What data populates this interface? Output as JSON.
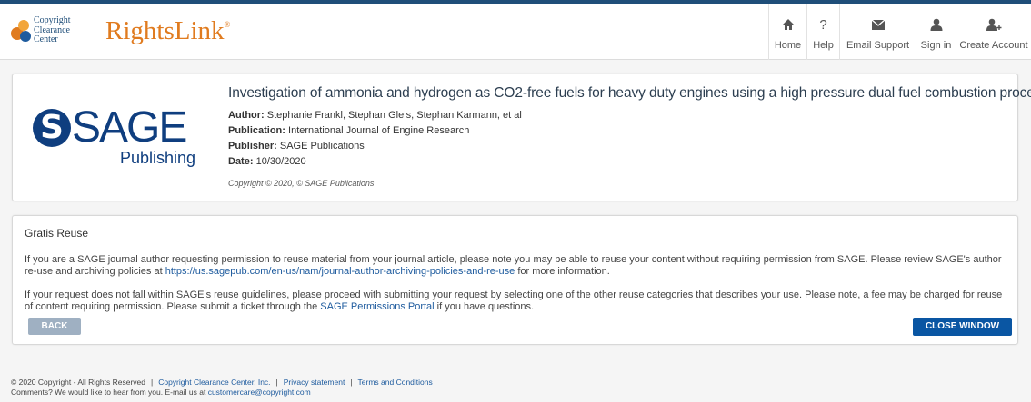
{
  "header": {
    "ccc_logo_lines": [
      "Copyright",
      "Clearance",
      "Center"
    ],
    "brand": "RightsLink",
    "brand_mark": "®",
    "nav": {
      "home": {
        "label": "Home",
        "icon": "home-icon"
      },
      "help": {
        "label": "Help",
        "icon": "help-icon",
        "glyph": "?"
      },
      "email": {
        "label": "Email Support",
        "icon": "envelope-icon"
      },
      "signin": {
        "label": "Sign in",
        "icon": "user-icon"
      },
      "create": {
        "label": "Create Account",
        "icon": "user-plus-icon"
      }
    }
  },
  "article": {
    "publisher_logo": {
      "word": "SAGE",
      "sub": "Publishing",
      "emblem": "S"
    },
    "title": "Investigation of ammonia and hydrogen as CO2-free fuels for heavy duty engines using a high pressure dual fuel combustion process",
    "author_label": "Author:",
    "author": "Stephanie Frankl, Stephan Gleis, Stephan Karmann, et al",
    "publication_label": "Publication:",
    "publication": "International Journal of Engine Research",
    "publisher_label": "Publisher:",
    "publisher": "SAGE Publications",
    "date_label": "Date:",
    "date": "10/30/2020",
    "copyright": "Copyright © 2020, © SAGE Publications"
  },
  "reuse": {
    "title": "Gratis Reuse",
    "p1_before": "If you are a SAGE journal author requesting permission to reuse material from your journal article, please note you may be able to reuse your content without requiring permission from SAGE. Please review SAGE's author re-use and archiving policies at ",
    "p1_link": "https://us.sagepub.com/en-us/nam/journal-author-archiving-policies-and-re-use",
    "p1_after": " for more information.",
    "p2_before": "If your request does not fall within SAGE's reuse guidelines, please proceed with submitting your request by selecting one of the other reuse categories that describes your use. Please note, a fee may be charged for reuse of content requiring permission. Please submit a ticket through the ",
    "p2_link": "SAGE Permissions Portal",
    "p2_after": " if you have questions.",
    "back_label": "BACK",
    "close_label": "CLOSE WINDOW"
  },
  "footer": {
    "copyright": "© 2020 Copyright - All Rights Reserved",
    "sep": "|",
    "ccc_link": "Copyright Clearance Center, Inc.",
    "privacy_link": "Privacy statement",
    "terms_link": "Terms and Conditions",
    "comments": "Comments? We would like to hear from you. E-mail us at ",
    "email_link": "customercare@copyright.com"
  },
  "colors": {
    "brand_orange": "#e07b1f",
    "sage_blue": "#0f3e7f",
    "primary_button": "#0a56a3",
    "disabled_button": "#9fb0c2",
    "link": "#1e5b9e"
  }
}
